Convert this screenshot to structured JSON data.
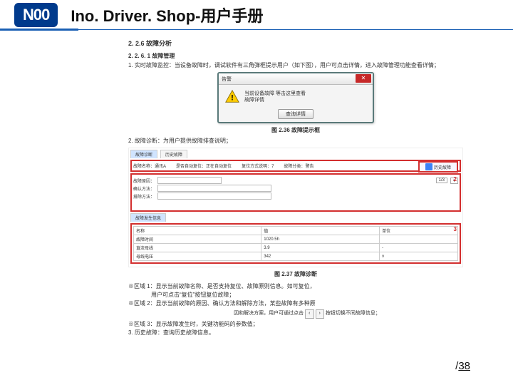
{
  "header": {
    "logo": "N00",
    "title": "Ino. Driver. Shop-用户手册"
  },
  "section": {
    "h": "2. 2.6 故障分析",
    "sub": "2. 2. 6. 1 故障管理",
    "p1_num": "1.",
    "p1": "实时故障监控：当设备故障时，调试软件有三角弹框提示用户（如下图），用户可点击详情，进入故障管理功能查看详情；",
    "p2_num": "2.",
    "p2": "故障诊断：为用户提供故障排查说明；"
  },
  "dialog": {
    "title": "告警",
    "line1": "当前设备故障 等击这里查看",
    "line2": "故障详情",
    "button": "查询详情",
    "close_alt": "关闭"
  },
  "figs": {
    "f1": "图 2.36 故障提示框",
    "f2": "图 2.37 故障诊断"
  },
  "diag": {
    "tab1": "故障诊断",
    "tab2": "历史故障",
    "row1": {
      "a_lbl": "故障名称：",
      "a_val": "通讯A",
      "b_lbl": "是否自动复位：",
      "b_val": "正在自动复位",
      "c_lbl": "复位方式说明：",
      "c_val": "7",
      "d_lbl": "故障分类：",
      "d_val": "警告"
    },
    "history_btn": "历史故障",
    "zone2": {
      "a_lbl": "故障原因：",
      "a_val": "",
      "b_lbl": "确认方法：",
      "c_lbl": "排除方法：",
      "page": "1/3"
    },
    "bottom_tab": "故障发生信息",
    "table": {
      "c0r0": "名称",
      "c1r0": "值",
      "c2r0": "单位",
      "c0r1": "故障时间",
      "c1r1": "1020.5h",
      "c2r1": "",
      "c0r2": "直流母线",
      "c1r2": "3.9",
      "c2r2": "-",
      "c0r3": "母线电压",
      "c1r3": "342",
      "c2r3": "v"
    },
    "markers": {
      "m1": "1",
      "m2": "2",
      "m3": "3"
    }
  },
  "notes": {
    "n1": "※区域 1：显示当前故障名称、是否支持复位、故障原则信息。如可复位，",
    "n1b": "用户可点击“复位”按钮复位故障；",
    "n2": "※区域 2：显示当前故障的原因、确认方法和解除方法，某些故障有多种原",
    "n2b": "因和解决方案，用户可通过点击",
    "n2c": "按钮切换不同故障信息；",
    "n3": "※区域 3：显示故障发生时，关键功能码的参数值；",
    "n4_num": "3.",
    "n4": "历史故障：查询历史故障信息。"
  },
  "page": {
    "slash": "/",
    "den": "38"
  }
}
